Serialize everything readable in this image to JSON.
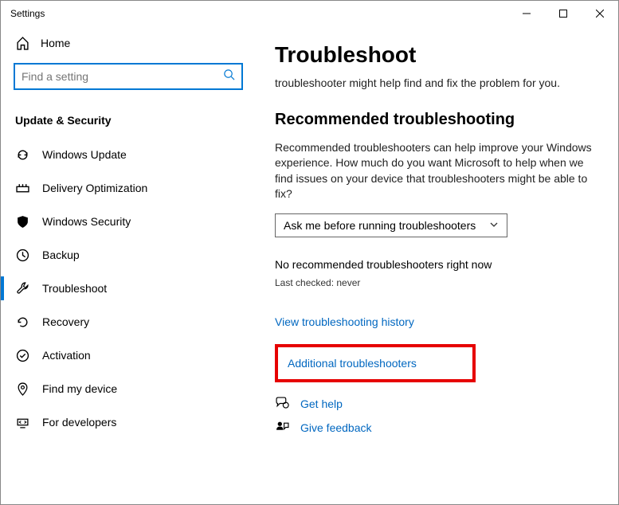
{
  "window": {
    "title": "Settings"
  },
  "sidebar": {
    "home": "Home",
    "search_placeholder": "Find a setting",
    "category": "Update & Security",
    "items": [
      {
        "label": "Windows Update"
      },
      {
        "label": "Delivery Optimization"
      },
      {
        "label": "Windows Security"
      },
      {
        "label": "Backup"
      },
      {
        "label": "Troubleshoot"
      },
      {
        "label": "Recovery"
      },
      {
        "label": "Activation"
      },
      {
        "label": "Find my device"
      },
      {
        "label": "For developers"
      }
    ]
  },
  "main": {
    "title": "Troubleshoot",
    "lead": "troubleshooter might help find and fix the problem for you.",
    "section_title": "Recommended troubleshooting",
    "section_body": "Recommended troubleshooters can help improve your Windows experience. How much do you want Microsoft to help when we find issues on your device that troubleshooters might be able to fix?",
    "select_value": "Ask me before running troubleshooters",
    "status_line": "No recommended troubleshooters right now",
    "last_checked": "Last checked: never",
    "link_history": "View troubleshooting history",
    "link_additional": "Additional troubleshooters",
    "get_help": "Get help",
    "give_feedback": "Give feedback"
  }
}
